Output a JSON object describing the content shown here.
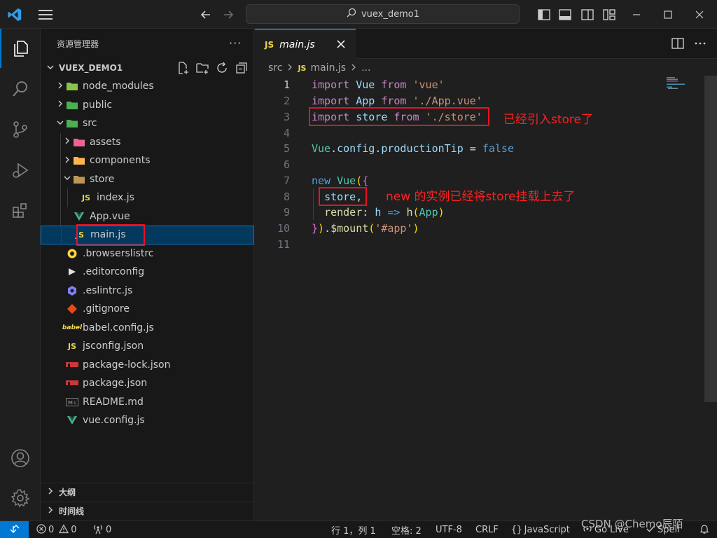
{
  "titlebar": {
    "search_text": "vuex_demo1",
    "icons": [
      "vscode-logo-icon",
      "hamburger-menu-icon",
      "arrow-left-icon",
      "arrow-right-icon",
      "search-icon",
      "toggle-sidebar-icon",
      "toggle-panel-icon",
      "toggle-secondary-sidebar-icon",
      "customize-layout-icon",
      "minimize-icon",
      "maximize-icon",
      "close-icon"
    ]
  },
  "activitybar": {
    "items": [
      "explorer-icon",
      "search-icon",
      "source-control-icon",
      "run-debug-icon",
      "extensions-icon"
    ],
    "bottom": [
      "accounts-icon",
      "settings-gear-icon"
    ],
    "accent": "#0078d4"
  },
  "sidebar": {
    "title": "资源管理器",
    "more": "···",
    "project": "VUEX_DEMO1",
    "outline": "大纲",
    "timeline": "时间线",
    "tree": [
      {
        "name": "node_modules",
        "depth": 1,
        "type": "folder",
        "open": false
      },
      {
        "name": "public",
        "depth": 1,
        "type": "folder",
        "open": false
      },
      {
        "name": "src",
        "depth": 1,
        "type": "folder",
        "open": true
      },
      {
        "name": "assets",
        "depth": 2,
        "type": "folder",
        "open": false
      },
      {
        "name": "components",
        "depth": 2,
        "type": "folder",
        "open": false
      },
      {
        "name": "store",
        "depth": 2,
        "type": "folder",
        "open": true
      },
      {
        "name": "index.js",
        "depth": 3,
        "type": "js"
      },
      {
        "name": "App.vue",
        "depth": 2,
        "type": "vue"
      },
      {
        "name": "main.js",
        "depth": 2,
        "type": "js",
        "selected": true
      },
      {
        "name": ".browserslistrc",
        "depth": 1,
        "type": "browserslist"
      },
      {
        "name": ".editorconfig",
        "depth": 1,
        "type": "editorconfig"
      },
      {
        "name": ".eslintrc.js",
        "depth": 1,
        "type": "eslint"
      },
      {
        "name": ".gitignore",
        "depth": 1,
        "type": "git"
      },
      {
        "name": "babel.config.js",
        "depth": 1,
        "type": "babel"
      },
      {
        "name": "jsconfig.json",
        "depth": 1,
        "type": "js"
      },
      {
        "name": "package-lock.json",
        "depth": 1,
        "type": "npm"
      },
      {
        "name": "package.json",
        "depth": 1,
        "type": "npm"
      },
      {
        "name": "README.md",
        "depth": 1,
        "type": "md"
      },
      {
        "name": "vue.config.js",
        "depth": 1,
        "type": "vue"
      }
    ]
  },
  "editor": {
    "tab_label": "main.js",
    "tab_icon": "JS",
    "breadcrumb": {
      "folder": "src",
      "file": "main.js",
      "tail": "..."
    },
    "lines": [
      "import Vue from 'vue'",
      "import App from './App.vue'",
      "import store from './store'",
      "",
      "Vue.config.productionTip = false",
      "",
      "new Vue({",
      "  store,",
      "  render: h => h(App)",
      "}).$mount('#app')",
      ""
    ],
    "annotations": {
      "import_note": "已经引入store了",
      "mount_note": "new 的实例已经将store挂载上去了"
    }
  },
  "statusbar": {
    "errors": "0",
    "warnings": "0",
    "ports": "0",
    "position": "行 1，列 1",
    "spaces": "空格: 2",
    "encoding": "UTF-8",
    "eol": "CRLF",
    "language": "JavaScript",
    "golive": "Go Live",
    "spell": "Spell",
    "watermark": "CSDN @Chemo辰陌"
  }
}
